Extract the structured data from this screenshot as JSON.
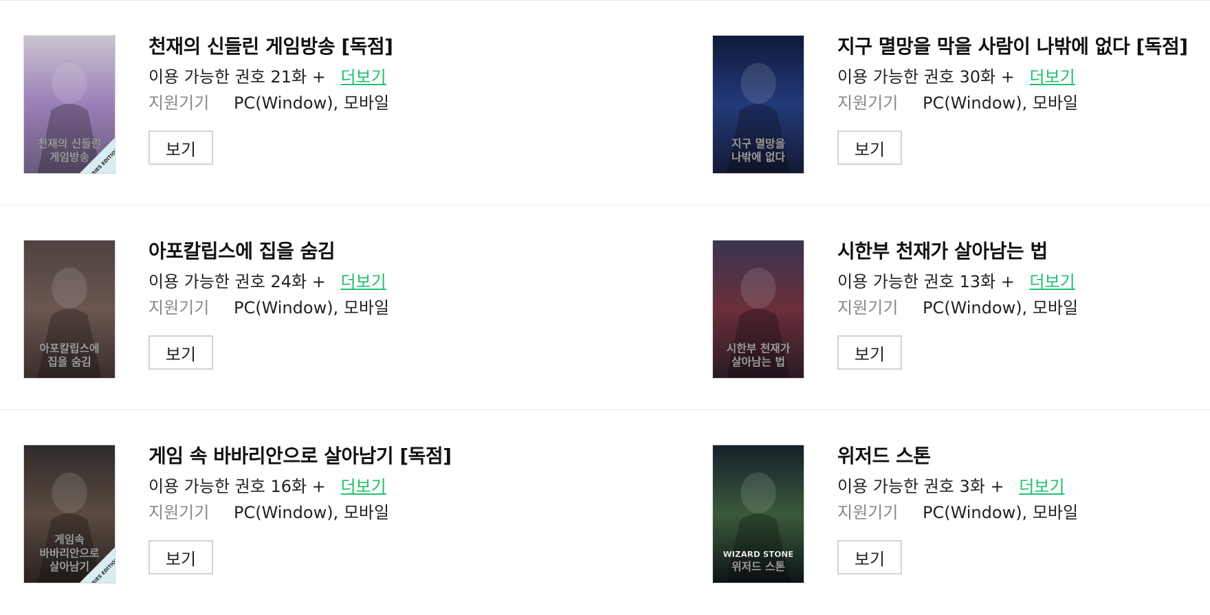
{
  "labels": {
    "available_prefix": "이용 가능한 권호",
    "more": "더보기",
    "device_label": "지원기기",
    "view_button": "보기"
  },
  "items": [
    {
      "title": "천재의 신들린 게임방송 [독점]",
      "episodes": "21화 +",
      "devices": "PC(Window), 모바일",
      "cover_text": [
        "천재의 신들린",
        "게임방송"
      ],
      "badge": "SERIES EDITION",
      "colors": {
        "top": "#c9c4cf",
        "mid": "#9a7fb8",
        "bottom": "#6a5a7a"
      }
    },
    {
      "title": "지구 멸망을 막을 사람이 나밖에 없다 [독점]",
      "episodes": "30화 +",
      "devices": "PC(Window), 모바일",
      "cover_text": [
        "지구 멸망을",
        "나밖에 없다"
      ],
      "badge": "",
      "colors": {
        "top": "#0e1a3a",
        "mid": "#233a7a",
        "bottom": "#141a33"
      }
    },
    {
      "title": "아포칼립스에 집을 숨김",
      "episodes": "24화 +",
      "devices": "PC(Window), 모바일",
      "cover_text": [
        "아포칼립스에",
        "집을 숨김"
      ],
      "badge": "",
      "colors": {
        "top": "#4d4240",
        "mid": "#6b5650",
        "bottom": "#3a2e2c"
      }
    },
    {
      "title": "시한부 천재가 살아남는 법",
      "episodes": "13화 +",
      "devices": "PC(Window), 모바일",
      "cover_text": [
        "시한부 천재가",
        "살아남는 법"
      ],
      "badge": "",
      "colors": {
        "top": "#3a3452",
        "mid": "#6a2f3a",
        "bottom": "#2a1a24"
      }
    },
    {
      "title": "게임 속 바바리안으로 살아남기 [독점]",
      "episodes": "16화 +",
      "devices": "PC(Window), 모바일",
      "cover_text": [
        "게임속",
        "바바리안으로",
        "살아남기"
      ],
      "badge": "SERIES EDITION",
      "colors": {
        "top": "#2f2b2a",
        "mid": "#5a4a40",
        "bottom": "#2a2220"
      }
    },
    {
      "title": "위저드 스톤",
      "episodes": "3화 +",
      "devices": "PC(Window), 모바일",
      "cover_text": [
        "WIZARD STONE",
        "위저드 스톤"
      ],
      "badge": "",
      "colors": {
        "top": "#16202a",
        "mid": "#3a5a3a",
        "bottom": "#0e1418"
      }
    }
  ]
}
